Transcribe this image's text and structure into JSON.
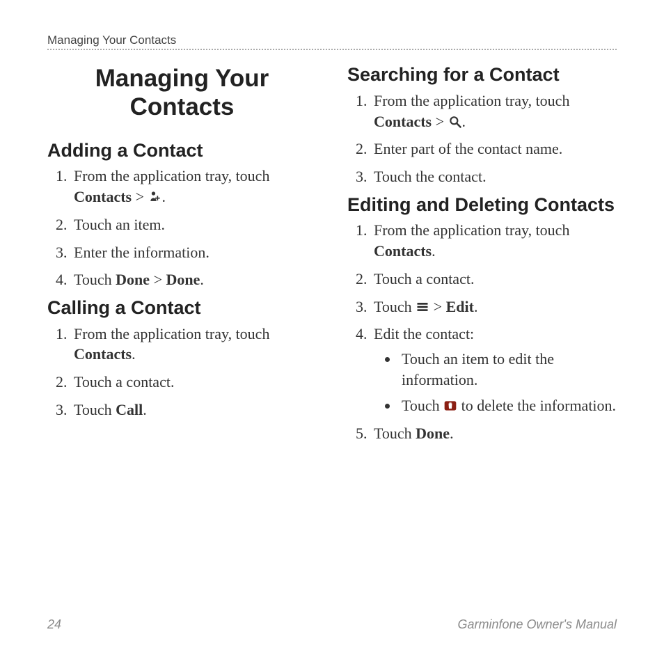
{
  "runningHead": "Managing Your Contacts",
  "title": "Managing Your Contacts",
  "left": {
    "sec1": {
      "h": "Adding a Contact",
      "s1a": "From the application tray, touch ",
      "s1b": "Contacts",
      "s1c": " > ",
      "s1d": ".",
      "s2": "Touch an item.",
      "s3": "Enter the information.",
      "s4a": "Touch ",
      "s4b": "Done",
      "s4c": " > ",
      "s4d": "Done",
      "s4e": "."
    },
    "sec2": {
      "h": "Calling a Contact",
      "s1a": "From the application tray, touch ",
      "s1b": "Contacts",
      "s1c": ".",
      "s2": "Touch a contact.",
      "s3a": "Touch ",
      "s3b": "Call",
      "s3c": "."
    }
  },
  "right": {
    "sec1": {
      "h": "Searching for a Contact",
      "s1a": "From the application tray, touch ",
      "s1b": "Contacts",
      "s1c": " > ",
      "s1d": ".",
      "s2": "Enter part of the contact name.",
      "s3": "Touch the contact."
    },
    "sec2": {
      "h": "Editing and Deleting Contacts",
      "s1a": "From the application tray, touch ",
      "s1b": "Contacts",
      "s1c": ".",
      "s2": "Touch a contact.",
      "s3a": "Touch ",
      "s3b": " > ",
      "s3c": "Edit",
      "s3d": ".",
      "s4": "Edit the contact:",
      "b1": "Touch an item to edit the information.",
      "b2a": "Touch ",
      "b2b": " to delete the information.",
      "s5a": "Touch ",
      "s5b": "Done",
      "s5c": "."
    }
  },
  "footer": {
    "page": "24",
    "owner": "Garminfone Owner's Manual"
  }
}
